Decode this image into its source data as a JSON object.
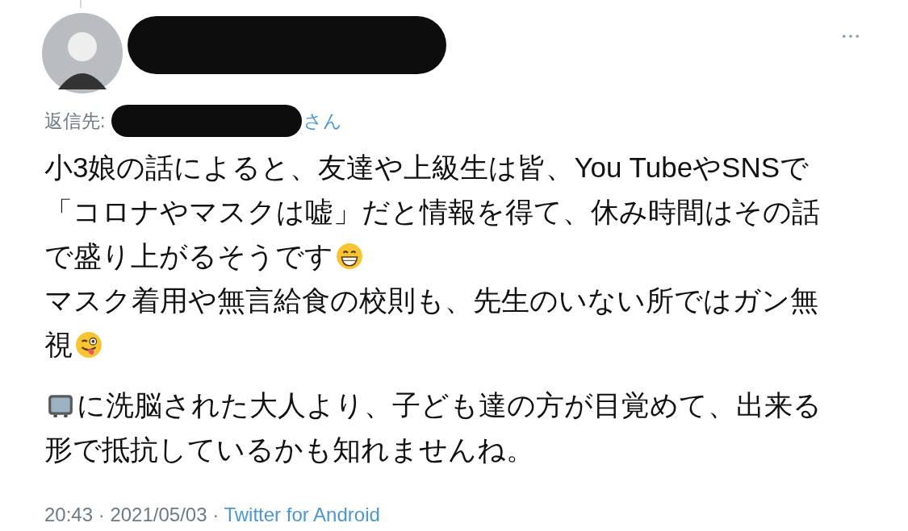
{
  "reply_to": {
    "label": "返信先:",
    "suffix": "さん"
  },
  "paragraphs": [
    [
      [
        {
          "kind": "text",
          "text": "小3娘の話によると、友達や上級生は皆、You TubeやSNSで"
        }
      ],
      [
        {
          "kind": "text",
          "text": "「コロナやマスクは嘘」だと情報を得て、休み時間はその話"
        }
      ],
      [
        {
          "kind": "text",
          "text": "で盛り上がるそうです"
        },
        {
          "kind": "grin"
        }
      ],
      [
        {
          "kind": "text",
          "text": "マスク着用や無言給食の校則も、先生のいない所ではガン無"
        }
      ],
      [
        {
          "kind": "text",
          "text": "視"
        },
        {
          "kind": "wink"
        }
      ]
    ],
    [
      [
        {
          "kind": "tv"
        },
        {
          "kind": "text",
          "text": "に洗脳された大人より、子ども達の方が目覚めて、出来る"
        }
      ],
      [
        {
          "kind": "text",
          "text": "形で抵抗しているかも知れませんね。"
        }
      ]
    ]
  ],
  "meta": {
    "timestamp": "20:43 · 2021/05/03 ·",
    "source": "Twitter for Android"
  }
}
